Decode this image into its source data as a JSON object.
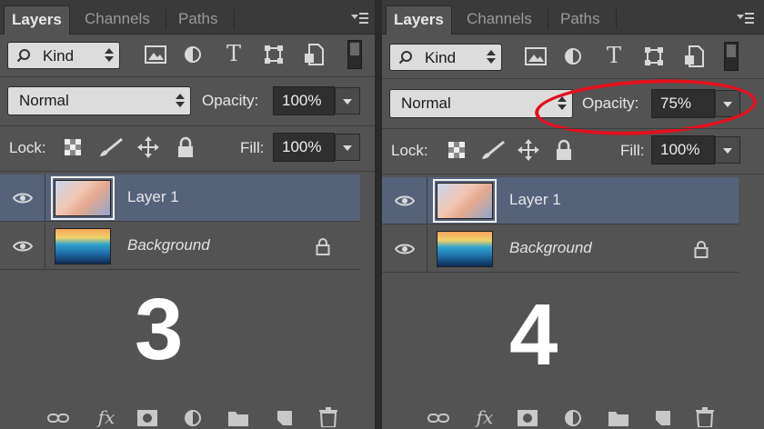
{
  "panels": [
    {
      "tabs": [
        "Layers",
        "Channels",
        "Paths"
      ],
      "filter_kind": "Kind",
      "blend_mode": "Normal",
      "opacity_label": "Opacity:",
      "opacity_value": "100%",
      "lock_label": "Lock:",
      "fill_label": "Fill:",
      "fill_value": "100%",
      "layers": [
        {
          "name": "Layer 1",
          "selected": true
        },
        {
          "name": "Background",
          "selected": false,
          "locked": true
        }
      ],
      "step_number": "3"
    },
    {
      "tabs": [
        "Layers",
        "Channels",
        "Paths"
      ],
      "filter_kind": "Kind",
      "blend_mode": "Normal",
      "opacity_label": "Opacity:",
      "opacity_value": "75%",
      "lock_label": "Lock:",
      "fill_label": "Fill:",
      "fill_value": "100%",
      "layers": [
        {
          "name": "Layer 1",
          "selected": true
        },
        {
          "name": "Background",
          "selected": false,
          "locked": true
        }
      ],
      "step_number": "4"
    }
  ],
  "icons": {
    "filter_icons": [
      "image-filter-icon",
      "adjustment-filter-icon",
      "type-filter-icon",
      "shape-filter-icon",
      "smart-object-filter-icon",
      "filter-toggle-icon"
    ],
    "lock_icons": [
      "lock-transparent-pixels-icon",
      "lock-image-pixels-icon",
      "lock-position-icon",
      "lock-all-icon"
    ],
    "footer_icons": [
      "link-layers-icon",
      "fx-icon",
      "layer-mask-icon",
      "adjustment-layer-icon",
      "group-folder-icon",
      "new-layer-icon",
      "trash-icon"
    ]
  },
  "colors": {
    "highlight_ring": "#e4101d",
    "selected_row": "#56627a"
  }
}
